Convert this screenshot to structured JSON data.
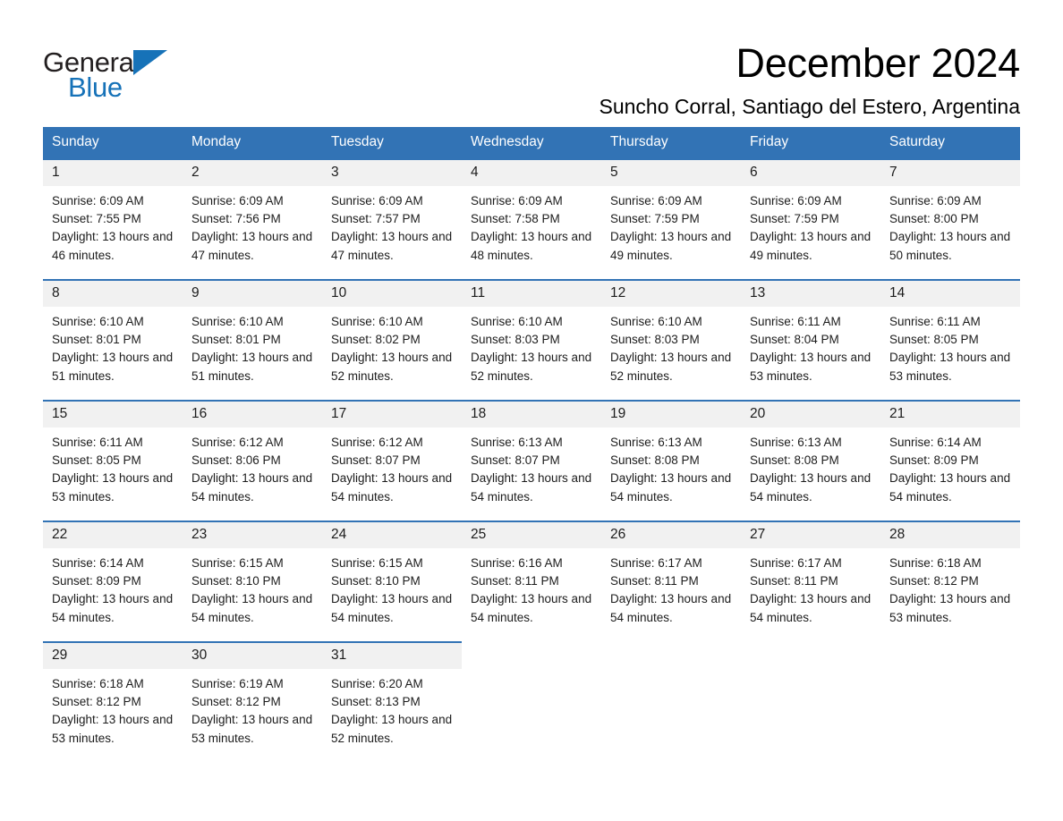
{
  "brand": {
    "name_part1": "General",
    "name_part2": "Blue",
    "accent_color": "#1672b8"
  },
  "header": {
    "month_title": "December 2024",
    "location": "Suncho Corral, Santiago del Estero, Argentina"
  },
  "calendar": {
    "header_bg": "#3273b5",
    "daynum_bg": "#f1f1f1",
    "weekday_headers": [
      "Sunday",
      "Monday",
      "Tuesday",
      "Wednesday",
      "Thursday",
      "Friday",
      "Saturday"
    ],
    "weeks": [
      [
        {
          "day": "1",
          "sunrise": "Sunrise: 6:09 AM",
          "sunset": "Sunset: 7:55 PM",
          "daylight": "Daylight: 13 hours and 46 minutes."
        },
        {
          "day": "2",
          "sunrise": "Sunrise: 6:09 AM",
          "sunset": "Sunset: 7:56 PM",
          "daylight": "Daylight: 13 hours and 47 minutes."
        },
        {
          "day": "3",
          "sunrise": "Sunrise: 6:09 AM",
          "sunset": "Sunset: 7:57 PM",
          "daylight": "Daylight: 13 hours and 47 minutes."
        },
        {
          "day": "4",
          "sunrise": "Sunrise: 6:09 AM",
          "sunset": "Sunset: 7:58 PM",
          "daylight": "Daylight: 13 hours and 48 minutes."
        },
        {
          "day": "5",
          "sunrise": "Sunrise: 6:09 AM",
          "sunset": "Sunset: 7:59 PM",
          "daylight": "Daylight: 13 hours and 49 minutes."
        },
        {
          "day": "6",
          "sunrise": "Sunrise: 6:09 AM",
          "sunset": "Sunset: 7:59 PM",
          "daylight": "Daylight: 13 hours and 49 minutes."
        },
        {
          "day": "7",
          "sunrise": "Sunrise: 6:09 AM",
          "sunset": "Sunset: 8:00 PM",
          "daylight": "Daylight: 13 hours and 50 minutes."
        }
      ],
      [
        {
          "day": "8",
          "sunrise": "Sunrise: 6:10 AM",
          "sunset": "Sunset: 8:01 PM",
          "daylight": "Daylight: 13 hours and 51 minutes."
        },
        {
          "day": "9",
          "sunrise": "Sunrise: 6:10 AM",
          "sunset": "Sunset: 8:01 PM",
          "daylight": "Daylight: 13 hours and 51 minutes."
        },
        {
          "day": "10",
          "sunrise": "Sunrise: 6:10 AM",
          "sunset": "Sunset: 8:02 PM",
          "daylight": "Daylight: 13 hours and 52 minutes."
        },
        {
          "day": "11",
          "sunrise": "Sunrise: 6:10 AM",
          "sunset": "Sunset: 8:03 PM",
          "daylight": "Daylight: 13 hours and 52 minutes."
        },
        {
          "day": "12",
          "sunrise": "Sunrise: 6:10 AM",
          "sunset": "Sunset: 8:03 PM",
          "daylight": "Daylight: 13 hours and 52 minutes."
        },
        {
          "day": "13",
          "sunrise": "Sunrise: 6:11 AM",
          "sunset": "Sunset: 8:04 PM",
          "daylight": "Daylight: 13 hours and 53 minutes."
        },
        {
          "day": "14",
          "sunrise": "Sunrise: 6:11 AM",
          "sunset": "Sunset: 8:05 PM",
          "daylight": "Daylight: 13 hours and 53 minutes."
        }
      ],
      [
        {
          "day": "15",
          "sunrise": "Sunrise: 6:11 AM",
          "sunset": "Sunset: 8:05 PM",
          "daylight": "Daylight: 13 hours and 53 minutes."
        },
        {
          "day": "16",
          "sunrise": "Sunrise: 6:12 AM",
          "sunset": "Sunset: 8:06 PM",
          "daylight": "Daylight: 13 hours and 54 minutes."
        },
        {
          "day": "17",
          "sunrise": "Sunrise: 6:12 AM",
          "sunset": "Sunset: 8:07 PM",
          "daylight": "Daylight: 13 hours and 54 minutes."
        },
        {
          "day": "18",
          "sunrise": "Sunrise: 6:13 AM",
          "sunset": "Sunset: 8:07 PM",
          "daylight": "Daylight: 13 hours and 54 minutes."
        },
        {
          "day": "19",
          "sunrise": "Sunrise: 6:13 AM",
          "sunset": "Sunset: 8:08 PM",
          "daylight": "Daylight: 13 hours and 54 minutes."
        },
        {
          "day": "20",
          "sunrise": "Sunrise: 6:13 AM",
          "sunset": "Sunset: 8:08 PM",
          "daylight": "Daylight: 13 hours and 54 minutes."
        },
        {
          "day": "21",
          "sunrise": "Sunrise: 6:14 AM",
          "sunset": "Sunset: 8:09 PM",
          "daylight": "Daylight: 13 hours and 54 minutes."
        }
      ],
      [
        {
          "day": "22",
          "sunrise": "Sunrise: 6:14 AM",
          "sunset": "Sunset: 8:09 PM",
          "daylight": "Daylight: 13 hours and 54 minutes."
        },
        {
          "day": "23",
          "sunrise": "Sunrise: 6:15 AM",
          "sunset": "Sunset: 8:10 PM",
          "daylight": "Daylight: 13 hours and 54 minutes."
        },
        {
          "day": "24",
          "sunrise": "Sunrise: 6:15 AM",
          "sunset": "Sunset: 8:10 PM",
          "daylight": "Daylight: 13 hours and 54 minutes."
        },
        {
          "day": "25",
          "sunrise": "Sunrise: 6:16 AM",
          "sunset": "Sunset: 8:11 PM",
          "daylight": "Daylight: 13 hours and 54 minutes."
        },
        {
          "day": "26",
          "sunrise": "Sunrise: 6:17 AM",
          "sunset": "Sunset: 8:11 PM",
          "daylight": "Daylight: 13 hours and 54 minutes."
        },
        {
          "day": "27",
          "sunrise": "Sunrise: 6:17 AM",
          "sunset": "Sunset: 8:11 PM",
          "daylight": "Daylight: 13 hours and 54 minutes."
        },
        {
          "day": "28",
          "sunrise": "Sunrise: 6:18 AM",
          "sunset": "Sunset: 8:12 PM",
          "daylight": "Daylight: 13 hours and 53 minutes."
        }
      ],
      [
        {
          "day": "29",
          "sunrise": "Sunrise: 6:18 AM",
          "sunset": "Sunset: 8:12 PM",
          "daylight": "Daylight: 13 hours and 53 minutes."
        },
        {
          "day": "30",
          "sunrise": "Sunrise: 6:19 AM",
          "sunset": "Sunset: 8:12 PM",
          "daylight": "Daylight: 13 hours and 53 minutes."
        },
        {
          "day": "31",
          "sunrise": "Sunrise: 6:20 AM",
          "sunset": "Sunset: 8:13 PM",
          "daylight": "Daylight: 13 hours and 52 minutes."
        },
        {
          "day": "",
          "sunrise": "",
          "sunset": "",
          "daylight": ""
        },
        {
          "day": "",
          "sunrise": "",
          "sunset": "",
          "daylight": ""
        },
        {
          "day": "",
          "sunrise": "",
          "sunset": "",
          "daylight": ""
        },
        {
          "day": "",
          "sunrise": "",
          "sunset": "",
          "daylight": ""
        }
      ]
    ]
  }
}
